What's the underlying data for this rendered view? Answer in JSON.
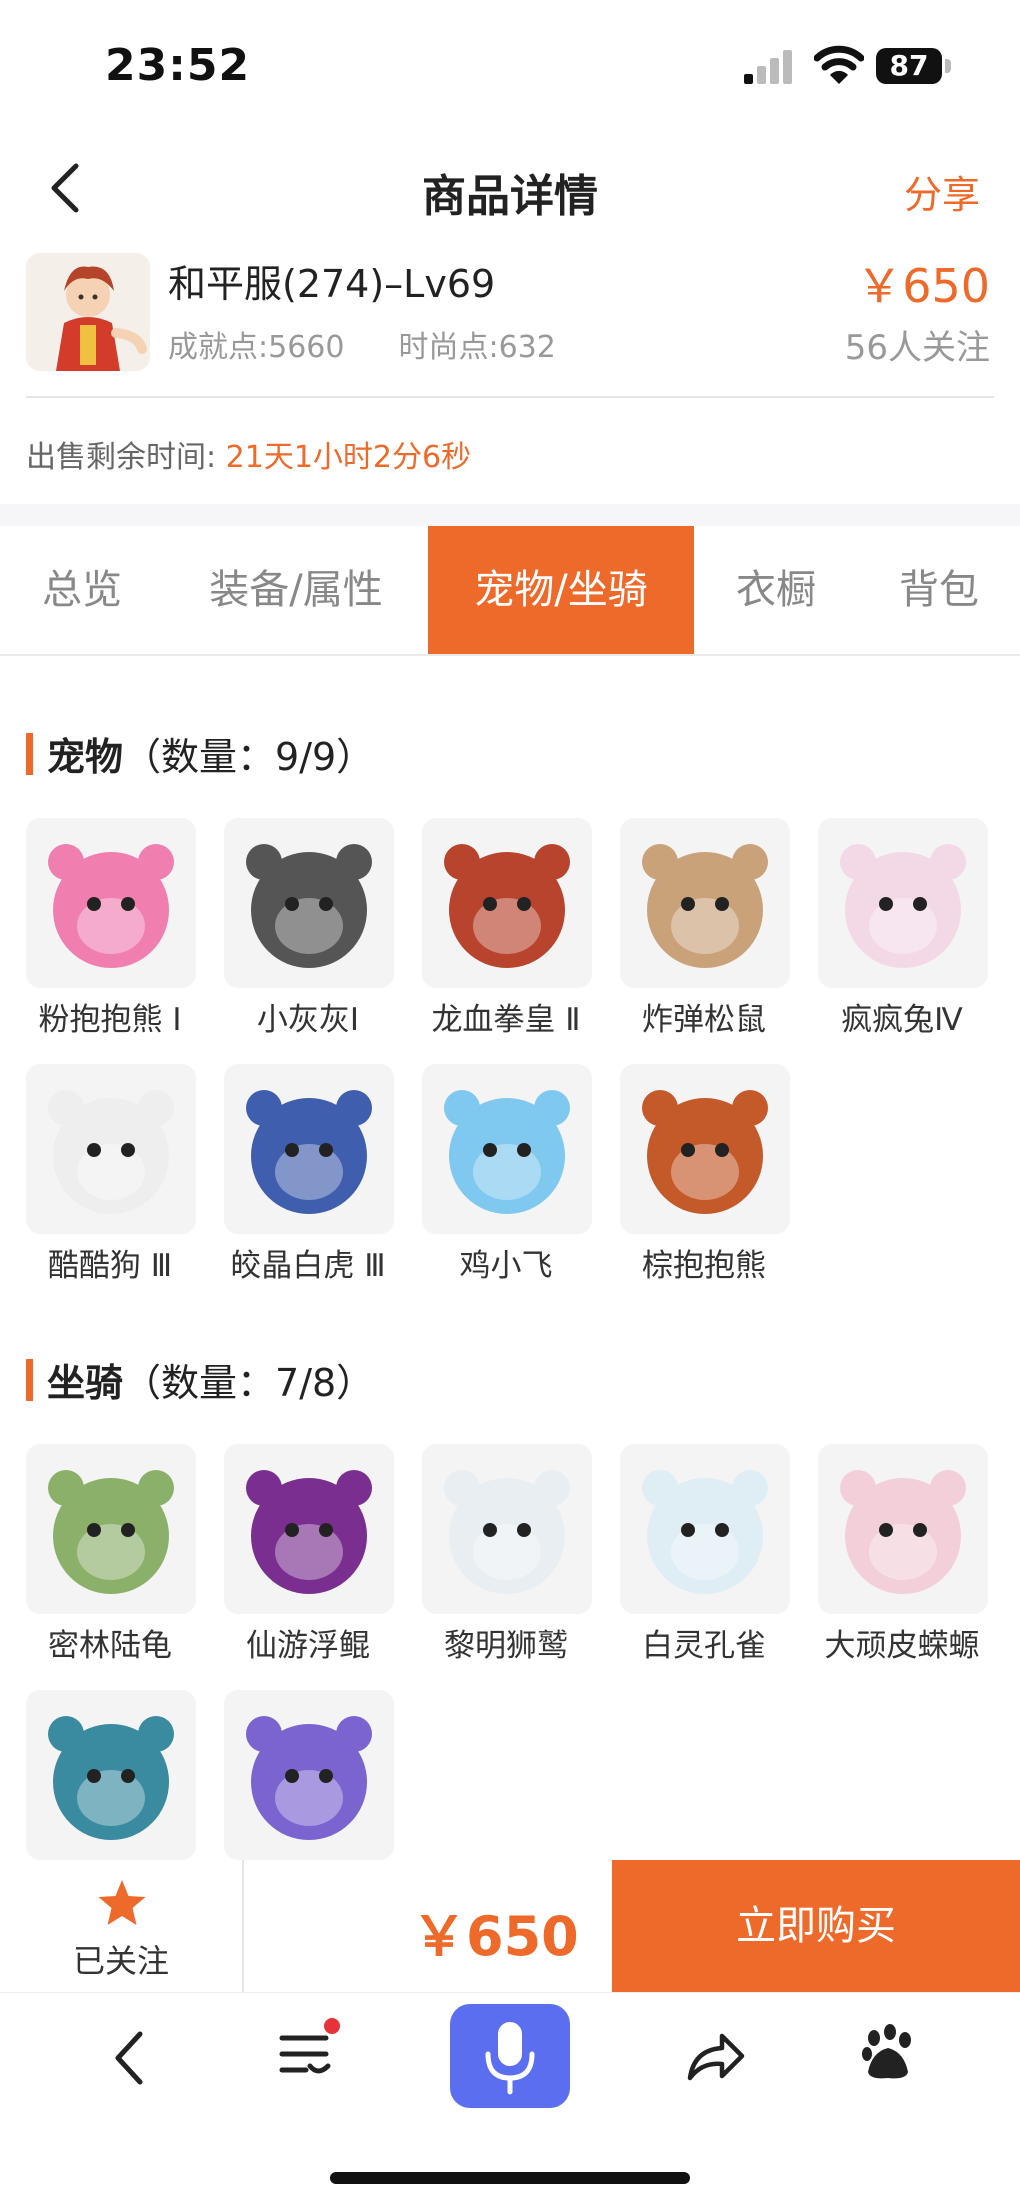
{
  "status_bar": {
    "time": "23:52",
    "battery": "87"
  },
  "header": {
    "title": "商品详情",
    "share_label": "分享"
  },
  "product": {
    "name": "和平服(274)–Lv69",
    "achievement": "成就点:5660",
    "fashion": "时尚点:632",
    "price": "￥650",
    "followers": "56人关注",
    "remaining_label": "出售剩余时间:",
    "remaining_value": "21天1小时2分6秒"
  },
  "tabs": [
    "总览",
    "装备/属性",
    "宠物/坐骑",
    "衣橱",
    "背包"
  ],
  "active_tab": "宠物/坐骑",
  "pets": {
    "title": "宠物",
    "count": "（数量：9/9）",
    "items": [
      {
        "name": "粉抱抱熊 I",
        "icon": "pink-bear-icon",
        "color": "#f07fb0"
      },
      {
        "name": "小灰灰I",
        "icon": "gray-dog-icon",
        "color": "#555555"
      },
      {
        "name": "龙血拳皇 Ⅱ",
        "icon": "dragon-icon",
        "color": "#b8442e"
      },
      {
        "name": "炸弹松鼠",
        "icon": "squirrel-icon",
        "color": "#c9a27a"
      },
      {
        "name": "疯疯兔Ⅳ",
        "icon": "rabbit-icon",
        "color": "#f3d9e6"
      },
      {
        "name": "酷酷狗 Ⅲ",
        "icon": "cool-dog-icon",
        "color": "#eeeeee"
      },
      {
        "name": "皎晶白虎 Ⅲ",
        "icon": "white-tiger-icon",
        "color": "#3f5fae"
      },
      {
        "name": "鸡小飞",
        "icon": "chick-icon",
        "color": "#7fc8ef"
      },
      {
        "name": "棕抱抱熊",
        "icon": "brown-bear-icon",
        "color": "#c45a2a"
      }
    ]
  },
  "mounts": {
    "title": "坐骑",
    "count": "（数量：7/8）",
    "items": [
      {
        "name": "密林陆龟",
        "icon": "turtle-icon",
        "color": "#8ab06a"
      },
      {
        "name": "仙游浮鲲",
        "icon": "fish-icon",
        "color": "#7a2e8f"
      },
      {
        "name": "黎明狮鹫",
        "icon": "griffin-icon",
        "color": "#e8eef2"
      },
      {
        "name": "白灵孔雀",
        "icon": "peacock-icon",
        "color": "#dfeef5"
      },
      {
        "name": "大顽皮蝾螈",
        "icon": "salamander-icon",
        "color": "#f2cfd9"
      },
      {
        "name": "",
        "icon": "phoenix-icon",
        "color": "#3a8aa0"
      },
      {
        "name": "",
        "icon": "purple-bird-icon",
        "color": "#7b63d0"
      }
    ]
  },
  "bottom_bar": {
    "follow_label": "已关注",
    "price": "￥650",
    "buy_label": "立即购买"
  },
  "colors": {
    "accent": "#ee6a2a",
    "mic": "#5b6ef0"
  }
}
